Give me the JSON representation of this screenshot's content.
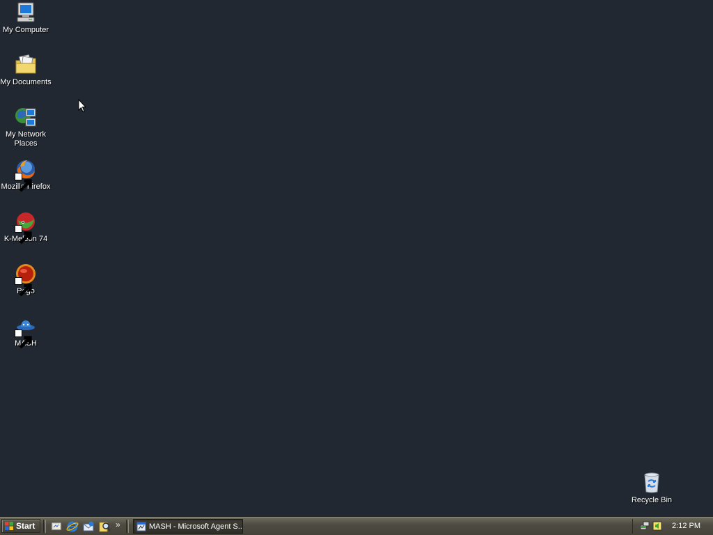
{
  "desktop": {
    "background_color": "#222831",
    "icons": [
      {
        "label": "My Computer",
        "icon": "computer-icon"
      },
      {
        "label": "My Documents",
        "icon": "folder-documents-icon"
      },
      {
        "label": "My Network Places",
        "icon": "network-places-icon"
      },
      {
        "label": "Mozilla Firefox",
        "icon": "firefox-icon"
      },
      {
        "label": "K-Meleon 74",
        "icon": "k-meleon-icon"
      },
      {
        "label": "Pego",
        "icon": "pego-icon"
      },
      {
        "label": "MASH",
        "icon": "mash-icon"
      },
      {
        "label": "Recycle Bin",
        "icon": "recycle-bin-icon"
      }
    ]
  },
  "taskbar": {
    "start_label": "Start",
    "quick_launch": [
      "show-desktop-icon",
      "internet-explorer-icon",
      "outlook-express-icon",
      "search-icon"
    ],
    "overflow_symbol": "»",
    "tasks": [
      {
        "label": "MASH - Microsoft Agent S...",
        "icon": "mash-agent-icon"
      }
    ],
    "tray_icons": [
      "network-tray-icon",
      "volume-tray-icon"
    ],
    "clock": "2:12 PM"
  }
}
